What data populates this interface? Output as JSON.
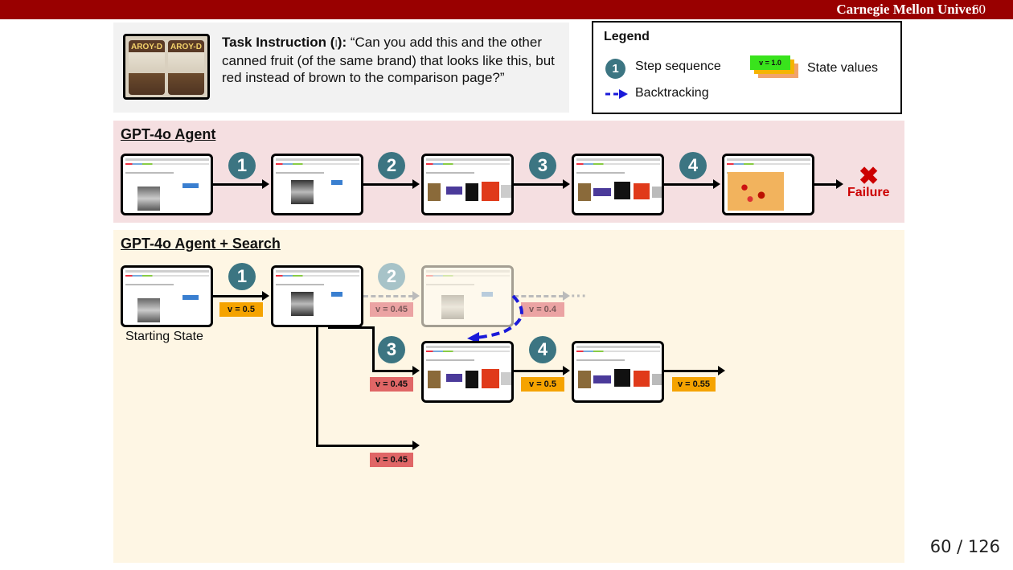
{
  "header": {
    "university": "Carnegie Mellon Univer",
    "slide_number": "60"
  },
  "task": {
    "label": "Task Instruction (",
    "cursor": "I",
    "close": "):",
    "text": " “Can you add this and the other canned fruit (of the same brand) that looks like this, but red instead of brown to the comparison page?”",
    "product_brand": "AROY-D"
  },
  "legend": {
    "title": "Legend",
    "step_sequence": "Step sequence",
    "step_example": "1",
    "backtracking": "Backtracking",
    "state_values": "State values",
    "value_example": "v = 1.0"
  },
  "panel_gpt4o": {
    "title": "GPT-4o Agent",
    "steps": [
      "1",
      "2",
      "3",
      "4"
    ],
    "failure": "Failure",
    "fail_mark": "✖"
  },
  "panel_search": {
    "title": "GPT-4o Agent + Search",
    "steps": [
      "1",
      "2",
      "3",
      "4"
    ],
    "starting_state": "Starting State",
    "ellipsis": "···",
    "values": {
      "v1": "v = 0.5",
      "v2_faded": "v = 0.45",
      "v_after_faded": "v = 0.4",
      "v3": "v = 0.45",
      "v4": "v = 0.5",
      "v_final": "v = 0.55",
      "v_branch": "v = 0.45"
    }
  },
  "colors": {
    "brand_red": "#990000",
    "step_teal": "#3c7582",
    "value_orange": "#f5a300",
    "value_red": "#e06666",
    "backtrack_blue": "#1a1ad9"
  },
  "footer": {
    "page": "60 / 126"
  }
}
